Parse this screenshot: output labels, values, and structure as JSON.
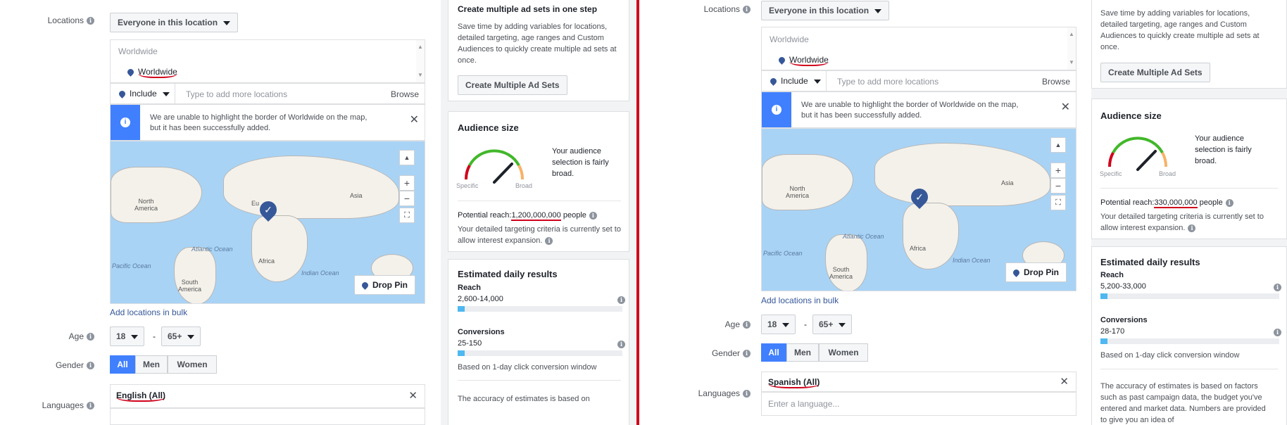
{
  "left": {
    "locations_label": "Locations",
    "location_type": "Everyone in this location",
    "list_header": "Worldwide",
    "selected_location": "Worldwide",
    "include_label": "Include",
    "location_placeholder": "Type to add more locations",
    "browse": "Browse",
    "notice_line1": "We are unable to highlight the border of Worldwide on the map,",
    "notice_line2": "but it has been successfully added.",
    "drop_pin": "Drop Pin",
    "add_bulk": "Add locations in bulk",
    "age_label": "Age",
    "age_min": "18",
    "age_sep": "-",
    "age_max": "65+",
    "gender_label": "Gender",
    "gender_all": "All",
    "gender_men": "Men",
    "gender_women": "Women",
    "languages_label": "Languages",
    "language_value": "English (All)",
    "map_labels": {
      "north_america": "North\nAmerica",
      "asia": "Asia",
      "europe": "Eu",
      "atlantic": "Atlantic Ocean",
      "pacific": "Pacific Ocean",
      "africa": "Africa",
      "indian": "Indian Ocean",
      "south_america": "South\nAmerica"
    }
  },
  "left_side": {
    "create_title": "Create multiple ad sets in one step",
    "create_desc": "Save time by adding variables for locations, detailed targeting, age ranges and Custom Audiences to quickly create multiple ad sets at once.",
    "create_btn": "Create Multiple Ad Sets",
    "audience_title": "Audience size",
    "specific": "Specific",
    "broad": "Broad",
    "audience_desc": "Your audience selection is fairly broad.",
    "reach_prefix": "Potential reach:",
    "reach_value": "1,200,000,000",
    "reach_suffix": " people",
    "targeting_note": "Your detailed targeting criteria is currently set to allow interest expansion.",
    "est_title": "Estimated daily results",
    "reach_label": "Reach",
    "reach_range": "2,600-14,000",
    "conv_label": "Conversions",
    "conv_range": "25-150",
    "conv_window": "Based on 1-day click conversion window",
    "accuracy": "The accuracy of estimates is based on"
  },
  "right": {
    "locations_label": "Locations",
    "location_type": "Everyone in this location",
    "list_header": "Worldwide",
    "selected_location": "Worldwide",
    "include_label": "Include",
    "location_placeholder": "Type to add more locations",
    "browse": "Browse",
    "notice_line1": "We are unable to highlight the border of Worldwide on the map,",
    "notice_line2": "but it has been successfully added.",
    "drop_pin": "Drop Pin",
    "add_bulk": "Add locations in bulk",
    "age_label": "Age",
    "age_min": "18",
    "age_sep": "-",
    "age_max": "65+",
    "gender_label": "Gender",
    "gender_all": "All",
    "gender_men": "Men",
    "gender_women": "Women",
    "languages_label": "Languages",
    "language_value": "Spanish (All)",
    "language_placeholder": "Enter a language...",
    "map_labels": {
      "north_america": "North\nAmerica",
      "asia": "Asia",
      "atlantic": "Atlantic Ocean",
      "pacific": "Pacific Ocean",
      "africa": "Africa",
      "indian": "Indian Ocean",
      "south_america": "South\nAmerica"
    }
  },
  "right_side": {
    "create_desc": "Save time by adding variables for locations, detailed targeting, age ranges and Custom Audiences to quickly create multiple ad sets at once.",
    "create_btn": "Create Multiple Ad Sets",
    "audience_title": "Audience size",
    "specific": "Specific",
    "broad": "Broad",
    "audience_desc": "Your audience selection is fairly broad.",
    "reach_prefix": "Potential reach:",
    "reach_value": "330,000,000",
    "reach_suffix": " people",
    "targeting_note": "Your detailed targeting criteria is currently set to allow interest expansion.",
    "est_title": "Estimated daily results",
    "reach_label": "Reach",
    "reach_range": "5,200-33,000",
    "conv_label": "Conversions",
    "conv_range": "28-170",
    "conv_window": "Based on 1-day click conversion window",
    "accuracy": "The accuracy of estimates is based on factors such as past campaign data, the budget you've entered and market data. Numbers are provided to give you an idea of"
  },
  "colors": {
    "accent": "#4080ff",
    "divider": "#d0021b",
    "bar": "#4fb8f0"
  }
}
